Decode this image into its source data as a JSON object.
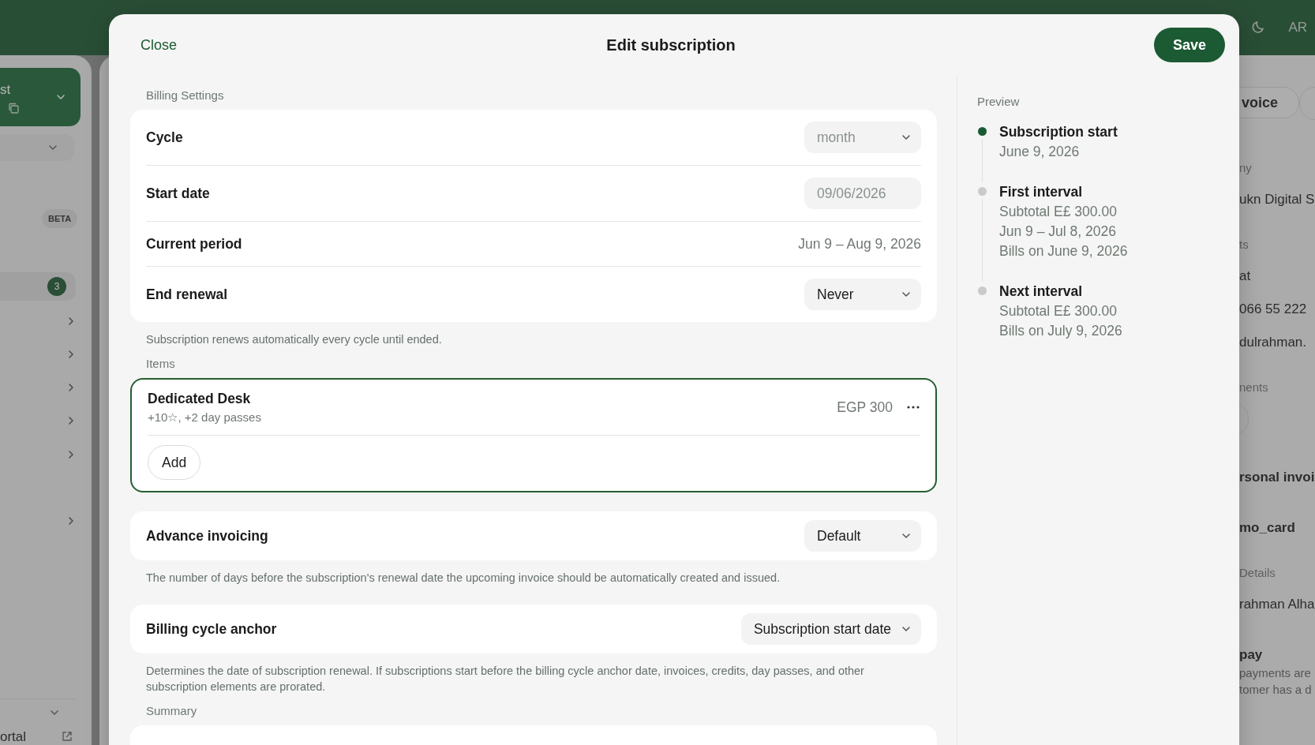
{
  "background": {
    "header": {
      "language": "AR"
    },
    "sidebar": {
      "account": "st",
      "beta_badge": "BETA",
      "count_badge": "3",
      "footer_link": "ortal"
    },
    "detail_panel": {
      "button": "voice",
      "texts": [
        {
          "kind": "label",
          "text": "ny"
        },
        {
          "kind": "value",
          "text": "ukn Digital S"
        },
        {
          "kind": "label",
          "text": "ts"
        },
        {
          "kind": "value",
          "text": "at"
        },
        {
          "kind": "value",
          "text": "066 55 222"
        },
        {
          "kind": "value",
          "text": "dulrahman."
        },
        {
          "kind": "label",
          "text": "nents"
        },
        {
          "kind": "chip"
        },
        {
          "kind": "heading",
          "text": "rsonal invoi"
        },
        {
          "kind": "heading",
          "text": "mo_card"
        },
        {
          "kind": "label",
          "text": "Details"
        },
        {
          "kind": "value",
          "text": "rahman Alha"
        },
        {
          "kind": "heading",
          "text": "pay"
        },
        {
          "kind": "small",
          "text": "payments are"
        },
        {
          "kind": "small",
          "text": "tomer has a d"
        }
      ]
    }
  },
  "modal": {
    "close": "Close",
    "title": "Edit subscription",
    "save": "Save",
    "billing_label": "Billing Settings",
    "billing_rows": [
      {
        "kind": "select",
        "label": "Cycle",
        "value": "month",
        "disabled": true
      },
      {
        "kind": "date",
        "label": "Start date",
        "value": "09/06/2026",
        "disabled": true
      },
      {
        "kind": "text",
        "label": "Current period",
        "value": "Jun 9 – Aug 9, 2026"
      },
      {
        "kind": "select",
        "label": "End renewal",
        "value": "Never",
        "disabled": false
      }
    ],
    "billing_note": "Subscription renews automatically every cycle until ended.",
    "items_label": "Items",
    "items": [
      {
        "name": "Dedicated Desk",
        "detail": "+10☆, +2 day passes",
        "price": "EGP 300"
      }
    ],
    "add_button": "Add",
    "settings": [
      {
        "label": "Advance invoicing",
        "value": "Default",
        "note": "The number of days before the subscription's renewal date the upcoming invoice should be automatically created and issued."
      },
      {
        "label": "Billing cycle anchor",
        "value": "Subscription start date",
        "note": "Determines the date of subscription renewal. If subscriptions start before the billing cycle anchor date, invoices, credits, day passes, and other subscription elements are prorated."
      }
    ],
    "summary_label": "Summary",
    "preview": {
      "title": "Preview",
      "events": [
        {
          "title": "Subscription start",
          "active": true,
          "lines": [
            "June 9, 2026"
          ]
        },
        {
          "title": "First interval",
          "active": false,
          "lines": [
            "Subtotal E£ 300.00",
            "Jun 9 – Jul 8, 2026",
            "Bills on June 9, 2026"
          ]
        },
        {
          "title": "Next interval",
          "active": false,
          "lines": [
            "Subtotal E£ 300.00",
            "Bills on July 9, 2026"
          ]
        }
      ]
    }
  }
}
